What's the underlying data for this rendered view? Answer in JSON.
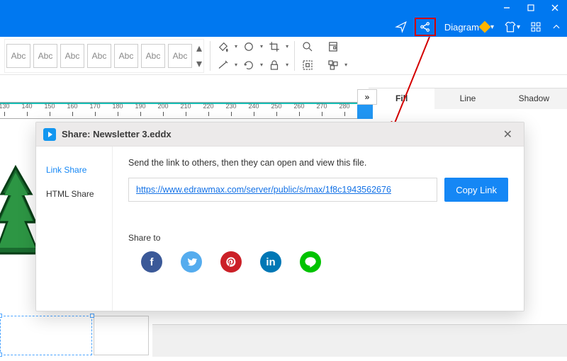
{
  "titlebar": {
    "diagram_label": "Diagram"
  },
  "toolbar": {
    "style_label": "Abc"
  },
  "right_panel": {
    "tabs": {
      "fill": "Fill",
      "line": "Line",
      "shadow": "Shadow"
    },
    "collapse": "»"
  },
  "ruler": {
    "ticks": [
      130,
      140,
      150,
      160,
      170,
      180,
      190,
      200,
      210,
      220,
      230,
      240,
      250,
      260,
      270,
      280
    ]
  },
  "dialog": {
    "title": "Share: Newsletter 3.eddx",
    "tabs": {
      "link": "Link Share",
      "html": "HTML Share"
    },
    "hint": "Send the link to others, then they can open and view this file.",
    "url": "https://www.edrawmax.com/server/public/s/max/1f8c1943562676",
    "copy": "Copy Link",
    "share_to": "Share to",
    "social": {
      "fb": "f",
      "tw": "",
      "pn": "",
      "li": "in",
      "ln": ""
    }
  }
}
